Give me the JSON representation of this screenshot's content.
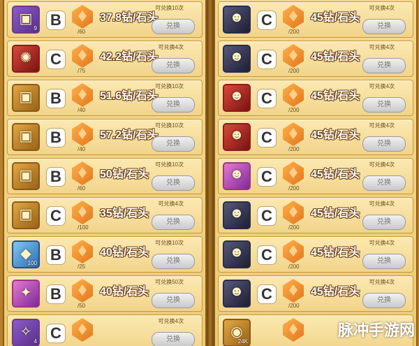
{
  "left": [
    {
      "icon": "treasure-chest-icon",
      "glyph": "▣",
      "rarity": "",
      "count": "9",
      "grade": "B",
      "have": "/60",
      "price": "37.8钻/石头",
      "limit": "可兑换10次",
      "button": "兑换"
    },
    {
      "icon": "claw-relic-icon",
      "glyph": "✺",
      "rarity": "rare-red",
      "count": "",
      "grade": "C",
      "have": "/75",
      "price": "42.2钻/石头",
      "limit": "可兑换4次",
      "button": "兑换"
    },
    {
      "icon": "treasure-chest-icon",
      "glyph": "▣",
      "rarity": "rare-gold",
      "count": "",
      "grade": "B",
      "have": "/40",
      "price": "51.6钻/石头",
      "limit": "可兑换10次",
      "button": "兑换"
    },
    {
      "icon": "treasure-chest-icon",
      "glyph": "▣",
      "rarity": "rare-gold",
      "count": "",
      "grade": "B",
      "have": "/40",
      "price": "57.2钻/石头",
      "limit": "可兑换10次",
      "button": "兑换"
    },
    {
      "icon": "treasure-chest-icon",
      "glyph": "▣",
      "rarity": "rare-gold",
      "count": "",
      "grade": "B",
      "have": "/60",
      "price": "50钻/石头",
      "limit": "可兑换10次",
      "button": "兑换"
    },
    {
      "icon": "treasure-chest-icon",
      "glyph": "▣",
      "rarity": "rare-gold",
      "count": "",
      "grade": "C",
      "have": "/100",
      "price": "35钻/石头",
      "limit": "可兑换4次",
      "button": "兑换"
    },
    {
      "icon": "crystal-icon",
      "glyph": "◆",
      "rarity": "rare-blue",
      "count": "100",
      "grade": "B",
      "have": "/25",
      "price": "40钻/石头",
      "limit": "可兑换10次",
      "button": "兑换"
    },
    {
      "icon": "crystal-icon",
      "glyph": "✦",
      "rarity": "rare-pink",
      "count": "",
      "grade": "B",
      "have": "/50",
      "price": "40钻/石头",
      "limit": "可兑换50次",
      "button": "兑换"
    },
    {
      "icon": "rune-icon",
      "glyph": "✧",
      "rarity": "",
      "count": "4",
      "grade": "C",
      "have": "",
      "price": "",
      "limit": "可兑换4次",
      "button": "兑换"
    }
  ],
  "right": [
    {
      "icon": "hero-portrait-icon",
      "glyph": "☻",
      "rarity": "rare-dark",
      "count": "",
      "grade": "C",
      "have": "/200",
      "price": "45钻/石头",
      "limit": "可兑换4次",
      "button": "兑换"
    },
    {
      "icon": "hero-portrait-icon",
      "glyph": "☻",
      "rarity": "rare-dark",
      "count": "",
      "grade": "C",
      "have": "/200",
      "price": "45钻/石头",
      "limit": "可兑换4次",
      "button": "兑换"
    },
    {
      "icon": "hero-portrait-icon",
      "glyph": "☻",
      "rarity": "rare-red",
      "count": "",
      "grade": "C",
      "have": "/200",
      "price": "45钻/石头",
      "limit": "可兑换4次",
      "button": "兑换"
    },
    {
      "icon": "hero-portrait-icon",
      "glyph": "☻",
      "rarity": "rare-red",
      "count": "",
      "grade": "C",
      "have": "/200",
      "price": "45钻/石头",
      "limit": "可兑换4次",
      "button": "兑换"
    },
    {
      "icon": "hero-portrait-icon",
      "glyph": "☻",
      "rarity": "rare-pink",
      "count": "",
      "grade": "C",
      "have": "/200",
      "price": "45钻/石头",
      "limit": "可兑换4次",
      "button": "兑换"
    },
    {
      "icon": "hero-portrait-icon",
      "glyph": "☻",
      "rarity": "rare-dark",
      "count": "",
      "grade": "C",
      "have": "/200",
      "price": "45钻/石头",
      "limit": "可兑换4次",
      "button": "兑换"
    },
    {
      "icon": "hero-portrait-icon",
      "glyph": "☻",
      "rarity": "rare-dark",
      "count": "",
      "grade": "C",
      "have": "/200",
      "price": "45钻/石头",
      "limit": "可兑换4次",
      "button": "兑换"
    },
    {
      "icon": "hero-portrait-icon",
      "glyph": "☻",
      "rarity": "rare-dark",
      "count": "",
      "grade": "C",
      "have": "/200",
      "price": "45钻/石头",
      "limit": "可兑换4次",
      "button": "兑换"
    },
    {
      "icon": "coin-icon",
      "glyph": "◉",
      "rarity": "rare-gold",
      "count": "24K",
      "grade": "",
      "have": "",
      "price": "",
      "limit": "",
      "button": ""
    }
  ],
  "watermark": "脉冲手游网"
}
